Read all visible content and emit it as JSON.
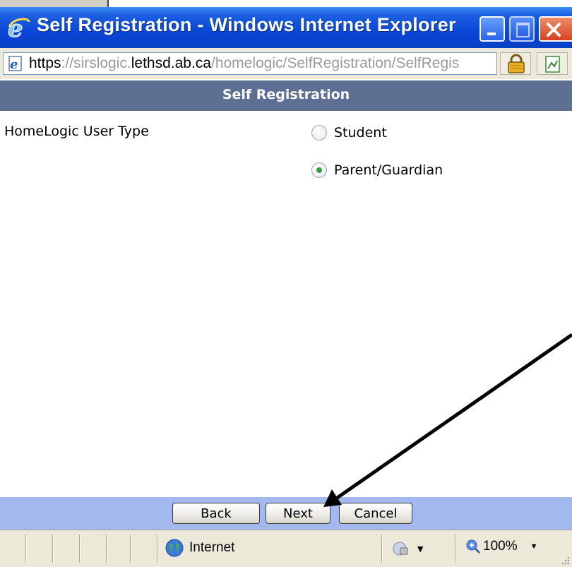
{
  "window": {
    "title": "Self Registration - Windows Internet Explorer"
  },
  "address_bar": {
    "url_scheme": "https",
    "url_sep": "://",
    "url_host_pre": "sirslogic.",
    "url_host_domain": "lethsd.ab.ca",
    "url_path": "/homelogic/SelfRegistration/SelfRegis"
  },
  "page": {
    "header_title": "Self Registration",
    "field_label": "HomeLogic User Type",
    "options": [
      {
        "label": "Student",
        "selected": false
      },
      {
        "label": "Parent/Guardian",
        "selected": true
      }
    ]
  },
  "buttons": {
    "back": "Back",
    "next": "Next",
    "cancel": "Cancel"
  },
  "status_bar": {
    "zone": "Internet",
    "zoom": "100%"
  },
  "colors": {
    "header_band": "#5e6f94",
    "button_bar": "#a4b8f0",
    "title_bar": "#0a46d6",
    "radio_checked": "#2f9a3f"
  },
  "icons": [
    "ie-logo-icon",
    "minimize-icon",
    "maximize-icon",
    "close-icon",
    "page-icon",
    "lock-icon",
    "rss-icon",
    "globe-icon",
    "protected-mode-icon",
    "zoom-icon",
    "resize-grip-icon"
  ]
}
